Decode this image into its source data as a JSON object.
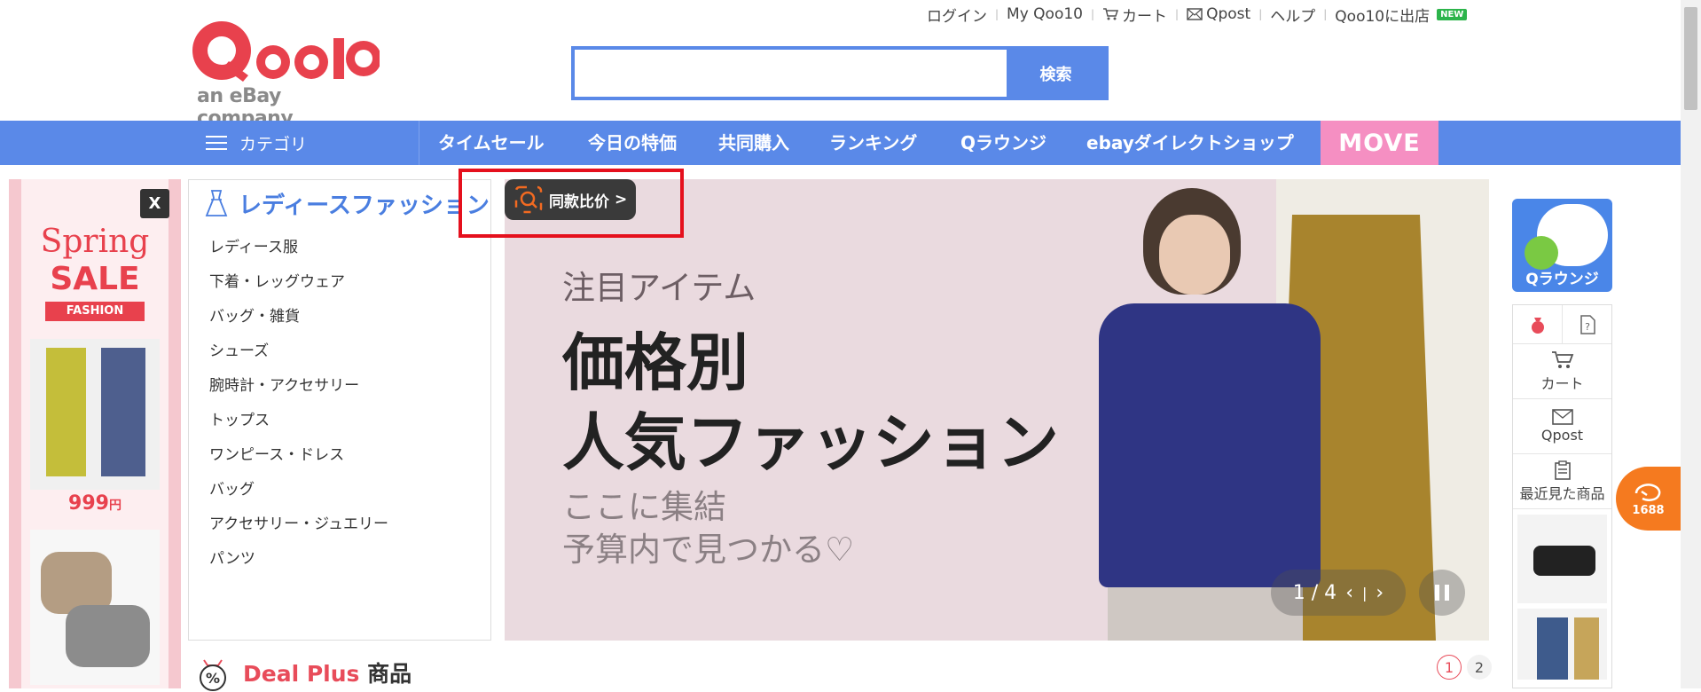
{
  "top_links": {
    "login": "ログイン",
    "my_qoo10": "My Qoo10",
    "cart": "カート",
    "qpost": "Qpost",
    "help": "ヘルプ",
    "sell": "Qoo10に出店",
    "new_badge": "NEW"
  },
  "logo": {
    "brand": "Qoo10",
    "tagline": "an eBay company"
  },
  "search": {
    "value": "",
    "button_label": "検索"
  },
  "nav": {
    "category_label": "カテゴリ",
    "items": [
      "タイムセール",
      "今日の特価",
      "共同購入",
      "ランキング",
      "Qラウンジ",
      "ebayダイレクトショップ"
    ],
    "move_label": "MOVE"
  },
  "left_ad": {
    "close_label": "X",
    "headline_1": "Spring",
    "headline_2": "SALE",
    "tag": "FASHION",
    "price_1": "999",
    "price_unit": "円"
  },
  "category_panel": {
    "title": "レディースファッション",
    "items": [
      "レディース服",
      "下着・レッグウェア",
      "バッグ・雑貨",
      "シューズ",
      "腕時計・アクセサリー",
      "トップス",
      "ワンピース・ドレス",
      "バッグ",
      "アクセサリー・ジュエリー",
      "パンツ"
    ]
  },
  "banner": {
    "subtitle": "注目アイテム",
    "title_line1": "価格別",
    "title_line2": "人気ファッション",
    "caption_line1": "ここに集結",
    "caption_line2": "予算内で見つかる♡",
    "pager": "1 / 4"
  },
  "compare_popup": {
    "label": "同款比价",
    "chevron": ">"
  },
  "deal_plus": {
    "title_1": "Deal Plus",
    "title_2": "商品",
    "pages": [
      "1",
      "2"
    ],
    "current_page": "1"
  },
  "right_sidebar": {
    "qlounge_label": "Qラウンジ",
    "cart_label": "カート",
    "qpost_label": "Qpost",
    "recent_label": "最近見た商品"
  },
  "badge_1688": "1688",
  "colors": {
    "nav_blue": "#5a89e8",
    "move_pink": "#f58fc2",
    "red_highlight": "#e5101d",
    "logo_red": "#e8414d",
    "deal_red": "#e84c5a",
    "badge_orange": "#f57a1f"
  }
}
